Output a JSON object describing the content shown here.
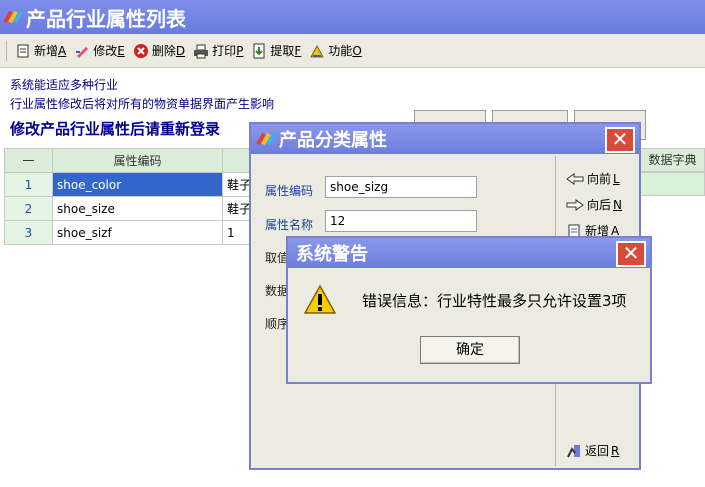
{
  "main": {
    "title": "产品行业属性列表",
    "toolbar": [
      {
        "label": "新增",
        "key": "A"
      },
      {
        "label": "修改",
        "key": "E"
      },
      {
        "label": "删除",
        "key": "D"
      },
      {
        "label": "打印",
        "key": "P"
      },
      {
        "label": "提取",
        "key": "F"
      },
      {
        "label": "功能",
        "key": "O"
      }
    ],
    "info1": "系统能适应多种行业",
    "info2": "行业属性修改后将对所有的物资单据界面产生影响",
    "info3": "修改产品行业属性后请重新登录",
    "grid": {
      "headers": [
        "一",
        "属性编码",
        "",
        "数据字典"
      ],
      "rows": [
        {
          "no": "1",
          "code": "shoe_color",
          "name": "鞋子"
        },
        {
          "no": "2",
          "code": "shoe_size",
          "name": "鞋子"
        },
        {
          "no": "3",
          "code": "shoe_sizf",
          "name": "1"
        }
      ]
    }
  },
  "category_dialog": {
    "title": "产品分类属性",
    "fields": [
      {
        "label": "属性编码",
        "value": "shoe_sizg"
      },
      {
        "label": "属性名称",
        "value": "12"
      },
      {
        "label": "取值",
        "value": ""
      },
      {
        "label": "数据",
        "value": ""
      },
      {
        "label": "顺序",
        "value": ""
      }
    ],
    "side_buttons": [
      {
        "label": "向前",
        "key": "L"
      },
      {
        "label": "向后",
        "key": "N"
      },
      {
        "label": "新增",
        "key": "A"
      },
      {
        "label": "返回",
        "key": "R"
      }
    ]
  },
  "warning_dialog": {
    "title": "系统警告",
    "message": "错误信息：行业特性最多只允许设置3项",
    "ok_label": "确定"
  },
  "colors": {
    "title_bar": "#6c7dde",
    "selected_row": "#3366cc",
    "grid_header": "#d9edd9",
    "close_button": "#d94a3a"
  }
}
